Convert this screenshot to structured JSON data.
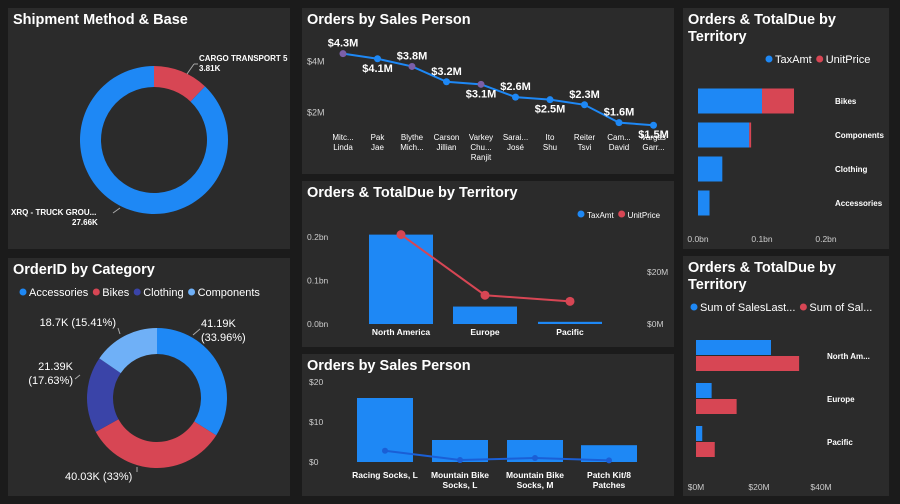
{
  "colors": {
    "blue": "#1e88f5",
    "red": "#d74654",
    "navy": "#3a44a8",
    "sky": "#6fb0f7",
    "lineblue": "#1a5fd6",
    "purple": "#7b5fa8"
  },
  "panels": {
    "p1": {
      "title": "Shipment Method & Base"
    },
    "p2": {
      "title": "Orders by Sales Person"
    },
    "p3": {
      "title": "Orders & TotalDue by Territory"
    },
    "p4": {
      "title": "Orders & TotalDue by Territory"
    },
    "p5": {
      "title": "OrderID by Category"
    },
    "p6": {
      "title": "Orders by Sales Person"
    },
    "p7": {
      "title": "Orders & TotalDue by Territory"
    }
  },
  "chart_data": [
    {
      "id": "p1",
      "type": "pie",
      "donut": true,
      "labels": [
        "CARGO TRANSPORT 5",
        "XRQ - TRUCK GROU..."
      ],
      "values": [
        3.81,
        27.66
      ],
      "display": [
        "3.81K",
        "27.66K"
      ],
      "colors": [
        "#d74654",
        "#1e88f5"
      ]
    },
    {
      "id": "p2",
      "type": "line",
      "categories": [
        "Mitc... Linda",
        "Pak Jae",
        "Blythe Mich...",
        "Carson Jillian",
        "Varkey Chu... Ranjit",
        "Sarai... José",
        "Ito Shu",
        "Reiter Tsvi",
        "Cam... David",
        "Vargas Garr..."
      ],
      "values": [
        4.3,
        4.1,
        3.8,
        3.2,
        3.1,
        2.6,
        2.5,
        2.3,
        1.6,
        1.5
      ],
      "data_labels": [
        "$4.3M",
        "$4.1M",
        "$3.8M",
        "$3.2M",
        "$3.1M",
        "$2.6M",
        "$2.5M",
        "$2.3M",
        "$1.6M",
        "$1.5M"
      ],
      "yticks": [
        {
          "v": 2,
          "label": "$2M"
        },
        {
          "v": 4,
          "label": "$4M"
        }
      ],
      "ylim": [
        1,
        4.6
      ]
    },
    {
      "id": "p3",
      "type": "bar",
      "orientation": "horizontal",
      "categories": [
        "Bikes",
        "Components",
        "Clothing",
        "Accessories"
      ],
      "series": [
        {
          "name": "TaxAmt",
          "values": [
            0.1,
            0.08,
            0.038,
            0.018
          ]
        },
        {
          "name": "UnitPrice",
          "values": [
            0.05,
            0.003,
            0,
            0
          ]
        }
      ],
      "xticks": [
        "0.0bn",
        "0.1bn",
        "0.2bn"
      ],
      "xlim": [
        0,
        0.2
      ]
    },
    {
      "id": "p4",
      "type": "bar",
      "categories": [
        "North America",
        "Europe",
        "Pacific"
      ],
      "series": [
        {
          "name": "TaxAmt",
          "values": [
            0.205,
            0.04,
            0.005
          ]
        },
        {
          "name": "UnitPrice",
          "values": [
            0.205,
            0.066,
            0.052
          ]
        }
      ],
      "yticks": [
        "0.0bn",
        "0.1bn",
        "0.2bn"
      ],
      "ylim": [
        0,
        0.25
      ],
      "y2ticks": [
        "$0M",
        "$20M"
      ]
    },
    {
      "id": "p5",
      "type": "pie",
      "donut": true,
      "legend": [
        "Accessories",
        "Bikes",
        "Clothing",
        "Components"
      ],
      "values": [
        41.19,
        40.03,
        21.39,
        18.7
      ],
      "display": [
        "41.19K (33.96%)",
        "40.03K (33%)",
        "21.39K (17.63%)",
        "18.7K (15.41%)"
      ],
      "colors": [
        "#1e88f5",
        "#d74654",
        "#3a44a8",
        "#6fb0f7"
      ]
    },
    {
      "id": "p6",
      "type": "bar",
      "categories": [
        "Racing Socks, L",
        "Mountain Bike Socks, L",
        "Mountain Bike Socks, M",
        "Patch Kit/8 Patches"
      ],
      "series": [
        {
          "name": "bars",
          "values": [
            16,
            5.5,
            5.5,
            4.2
          ]
        },
        {
          "name": "line",
          "values": [
            2.8,
            0.5,
            1,
            0.4
          ]
        }
      ],
      "yticks": [
        "$0",
        "$10",
        "$20"
      ],
      "ylim": [
        0,
        22
      ]
    },
    {
      "id": "p7",
      "type": "bar",
      "orientation": "horizontal",
      "categories": [
        "North Am...",
        "Europe",
        "Pacific"
      ],
      "series": [
        {
          "name": "Sum of SalesLast...",
          "values": [
            24,
            5,
            2
          ]
        },
        {
          "name": "Sum of Sal...",
          "values": [
            33,
            13,
            6
          ]
        }
      ],
      "xticks": [
        "$0M",
        "$20M",
        "$40M"
      ],
      "xlim": [
        0,
        40
      ]
    }
  ]
}
